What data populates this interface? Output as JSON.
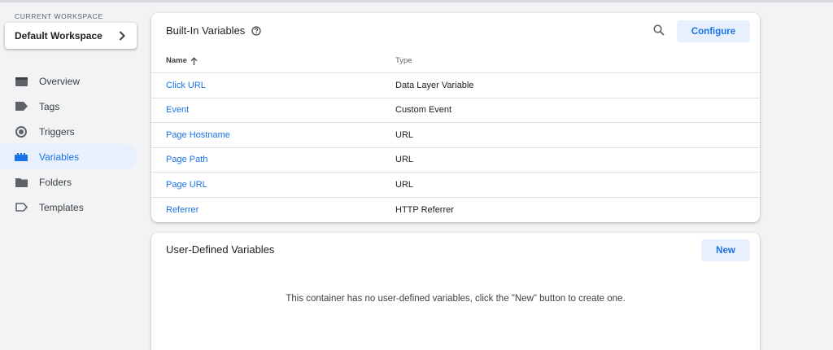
{
  "workspace": {
    "label": "CURRENT WORKSPACE",
    "name": "Default Workspace"
  },
  "nav": {
    "items": [
      {
        "label": "Overview",
        "icon": "overview-icon"
      },
      {
        "label": "Tags",
        "icon": "tag-icon"
      },
      {
        "label": "Triggers",
        "icon": "trigger-icon"
      },
      {
        "label": "Variables",
        "icon": "variables-icon",
        "active": true
      },
      {
        "label": "Folders",
        "icon": "folder-icon"
      },
      {
        "label": "Templates",
        "icon": "template-icon"
      }
    ]
  },
  "builtin": {
    "title": "Built-In Variables",
    "configure_label": "Configure",
    "columns": {
      "name": "Name",
      "type": "Type"
    },
    "rows": [
      {
        "name": "Click URL",
        "type": "Data Layer Variable"
      },
      {
        "name": "Event",
        "type": "Custom Event"
      },
      {
        "name": "Page Hostname",
        "type": "URL"
      },
      {
        "name": "Page Path",
        "type": "URL"
      },
      {
        "name": "Page URL",
        "type": "URL"
      },
      {
        "name": "Referrer",
        "type": "HTTP Referrer"
      }
    ]
  },
  "user_defined": {
    "title": "User-Defined Variables",
    "new_label": "New",
    "empty_message": "This container has no user-defined variables, click the \"New\" button to create one."
  },
  "colors": {
    "accent": "#1a73e8",
    "active_bg": "#e8f0fe",
    "page_bg": "#f1f3f4"
  }
}
